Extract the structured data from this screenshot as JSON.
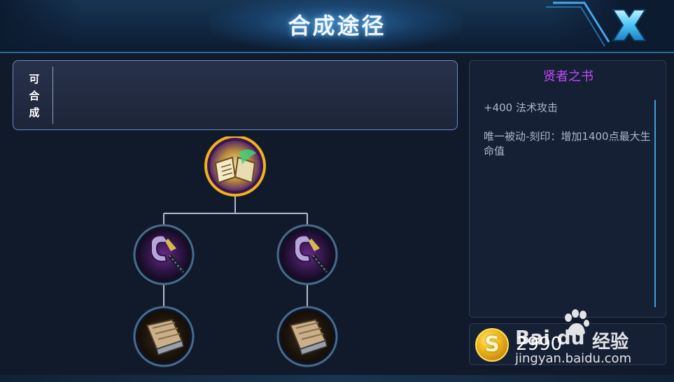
{
  "header": {
    "title": "合成途径"
  },
  "craft": {
    "label_lines": [
      "可",
      "合",
      "成"
    ]
  },
  "item": {
    "name": "贤者之书",
    "stat": "+400 法术攻击",
    "passive": "唯一被动-刻印：增加1400点最大生命值",
    "price": "2990",
    "name_color": "#c14bff"
  },
  "tree": {
    "root": "sages-book",
    "children": [
      "arcane-staff",
      "arcane-staff"
    ],
    "grandchildren": [
      "wooden-book",
      "wooden-book"
    ]
  },
  "icons": {
    "close": "close-x-icon",
    "coin": "gold-coin-icon"
  },
  "watermark": {
    "logo": "Bai du",
    "site": "经验",
    "url": "jingyan.baidu.com"
  }
}
